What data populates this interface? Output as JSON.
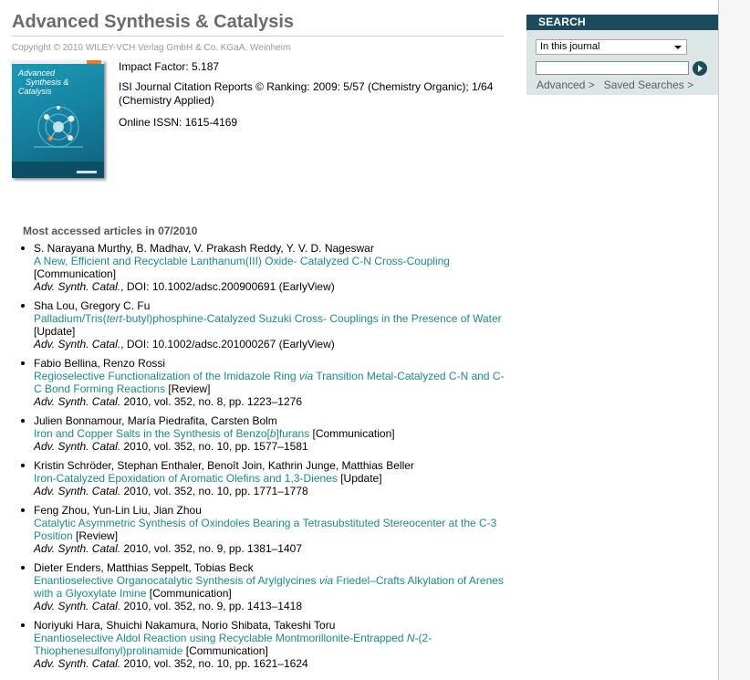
{
  "journal": {
    "title": "Advanced Synthesis & Catalysis",
    "copyright": "Copyright © 2010 WILEY-VCH Verlag GmbH & Co. KGaA, Weinheim",
    "impact_factor": "Impact Factor: 5.187",
    "ranking": "ISI Journal Citation Reports © Ranking: 2009: 5/57 (Chemistry Organic); 1/64 (Chemistry Applied)",
    "issn": "Online ISSN: 1615-4169",
    "cover": {
      "line1": "Advanced",
      "line2": "Synthesis &",
      "line3": "Catalysis",
      "colors": {
        "primary": "#1684a3",
        "dark": "#0b4e66",
        "accent": "#e8782a"
      }
    }
  },
  "most_accessed": {
    "heading": "Most accessed articles in 07/2010",
    "articles": [
      {
        "authors": "S. Narayana Murthy, B. Madhav, V. Prakash Reddy, Y. V. D. Nageswar",
        "title_parts": [
          "A New, Efficient and Recyclable Lanthanum(III) Oxide- Catalyzed C-N Cross-Coupling"
        ],
        "type": "[Communication]",
        "journal": "Adv. Synth. Catal.",
        "citation": ", DOI: 10.1002/adsc.200900691 (EarlyView)"
      },
      {
        "authors": "Sha Lou, Gregory C. Fu",
        "title_parts": [
          "Palladium/Tris(",
          "tert",
          "-butyl)phosphine-Catalyzed Suzuki Cross- Couplings in the Presence of Water"
        ],
        "type": "[Update]",
        "journal": "Adv. Synth. Catal.",
        "citation": ", DOI: 10.1002/adsc.201000267 (EarlyView)"
      },
      {
        "authors": "Fabio Bellina, Renzo Rossi",
        "title_parts": [
          "Regioselective Functionalization of the Imidazole Ring ",
          "via",
          " Transition Metal-Catalyzed C-N and C-C Bond Forming Reactions"
        ],
        "type": "[Review]",
        "journal": "Adv. Synth. Catal.",
        "citation": " 2010, vol. 352, no. 8, pp. 1223–1276"
      },
      {
        "authors": "Julien Bonnamour, María Piedrafita, Carsten Bolm",
        "title_parts": [
          "Iron and Copper Salts in the Synthesis of Benzo[",
          "b",
          "]furans"
        ],
        "type": "[Communication]",
        "journal": "Adv. Synth. Catal.",
        "citation": " 2010, vol. 352, no. 10, pp. 1577–1581"
      },
      {
        "authors": "Kristin Schröder, Stephan Enthaler, Benoît Join, Kathrin Junge, Matthias Beller",
        "title_parts": [
          "Iron-Catalyzed Epoxidation of Aromatic Olefins and 1,3-Dienes"
        ],
        "type": "[Update]",
        "journal": "Adv. Synth. Catal.",
        "citation": " 2010, vol. 352, no. 10, pp. 1771–1778"
      },
      {
        "authors": "Feng Zhou, Yun-Lin Liu, Jian Zhou",
        "title_parts": [
          "Catalytic Asymmetric Synthesis of Oxindoles Bearing a Tetrasubstituted Stereocenter at the C-3 Position"
        ],
        "type": "[Review]",
        "journal": "Adv. Synth. Catal.",
        "citation": " 2010, vol. 352, no. 9, pp. 1381–1407"
      },
      {
        "authors": "Dieter Enders, Matthias Seppelt, Tobias Beck",
        "title_parts": [
          "Enantioselective Organocatalytic Synthesis of Arylglycines ",
          "via",
          " Friedel–Crafts Alkylation of Arenes with a Glyoxylate Imine"
        ],
        "type": "[Communication]",
        "journal": "Adv. Synth. Catal.",
        "citation": " 2010, vol. 352, no. 9, pp. 1413–1418"
      },
      {
        "authors": "Noriyuki Hara, Shuichi Nakamura, Norio Shibata, Takeshi Toru",
        "title_parts": [
          "Enantioselective Aldol Reaction using Recyclable Montmorillonite-Entrapped ",
          "N",
          "-(2-Thiophenesulfonyl)prolinamide"
        ],
        "type": "[Communication]",
        "journal": "Adv. Synth. Catal.",
        "citation": " 2010, vol. 352, no. 10, pp. 1621–1624"
      }
    ]
  },
  "search": {
    "heading": "SEARCH",
    "scope": "In this journal",
    "query": "",
    "advanced_label": "Advanced >",
    "saved_label": "Saved Searches >"
  }
}
